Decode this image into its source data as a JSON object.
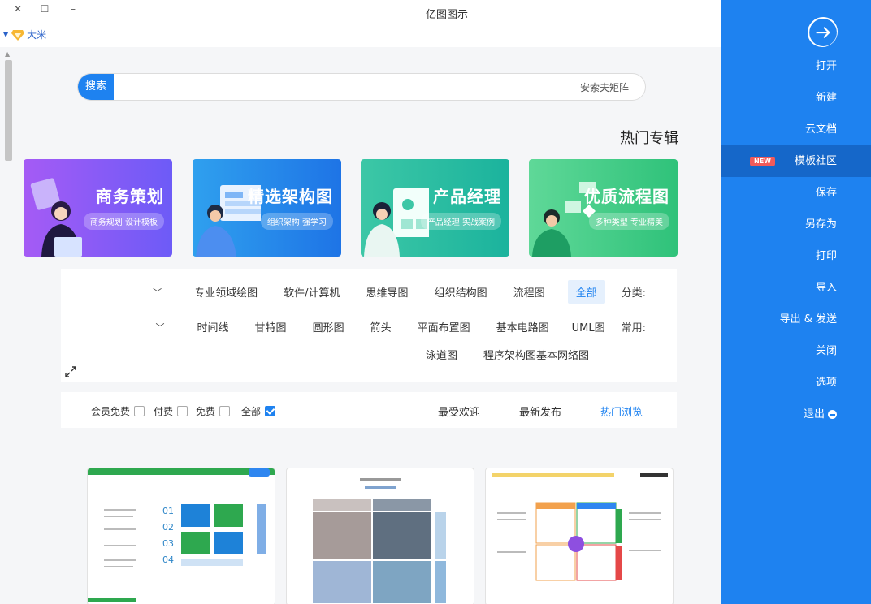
{
  "window": {
    "title": "亿图图示",
    "close_glyph": "✕",
    "maximize_glyph": "☐",
    "minimize_glyph": "–"
  },
  "user": {
    "name": "大米"
  },
  "search": {
    "button_label": "搜索",
    "value": "安索夫矩阵"
  },
  "hot_section_title": "热门专辑",
  "banners": [
    {
      "title": "商务策划",
      "subtitle": "商务规划 设计模板",
      "color_start": "#a55bf5",
      "color_end": "#6d5bf7"
    },
    {
      "title": "精选架构图",
      "subtitle": "组织架构 强学习",
      "color_start": "#2fa0ee",
      "color_end": "#1e74e6"
    },
    {
      "title": "产品经理",
      "subtitle": "产品经理 实战案例",
      "color_start": "#3cc7a6",
      "color_end": "#1bb39d"
    },
    {
      "title": "优质流程图",
      "subtitle": "多种类型 专业精美",
      "color_start": "#5fd898",
      "color_end": "#2fc27a"
    }
  ],
  "filters": {
    "category_label": "分类:",
    "categories": [
      "全部",
      "流程图",
      "组织结构图",
      "思维导图",
      "软件/计算机",
      "专业领域绘图"
    ],
    "common_label": "常用:",
    "common_row1": [
      "UML图",
      "基本电路图",
      "平面布置图",
      "箭头",
      "圆形图",
      "甘特图",
      "时间线"
    ],
    "common_row2": [
      "基本网络图",
      "程序架构图",
      "泳道图"
    ],
    "expand_glyph": "﹀"
  },
  "sort": {
    "tabs": [
      "热门浏览",
      "最新发布",
      "最受欢迎"
    ],
    "checks": [
      "全部",
      "免费",
      "付费",
      "会员免费"
    ]
  },
  "sidebar": {
    "items": [
      "打开",
      "新建",
      "云文档",
      "模板社区",
      "保存",
      "另存为",
      "打印",
      "导入",
      "导出 & 发送",
      "关闭",
      "选项",
      "退出"
    ],
    "new_badge": "NEW"
  },
  "colors": {
    "accent": "#1e82f0",
    "sidebar_active": "#1567c9",
    "badge": "#f15a5a"
  }
}
